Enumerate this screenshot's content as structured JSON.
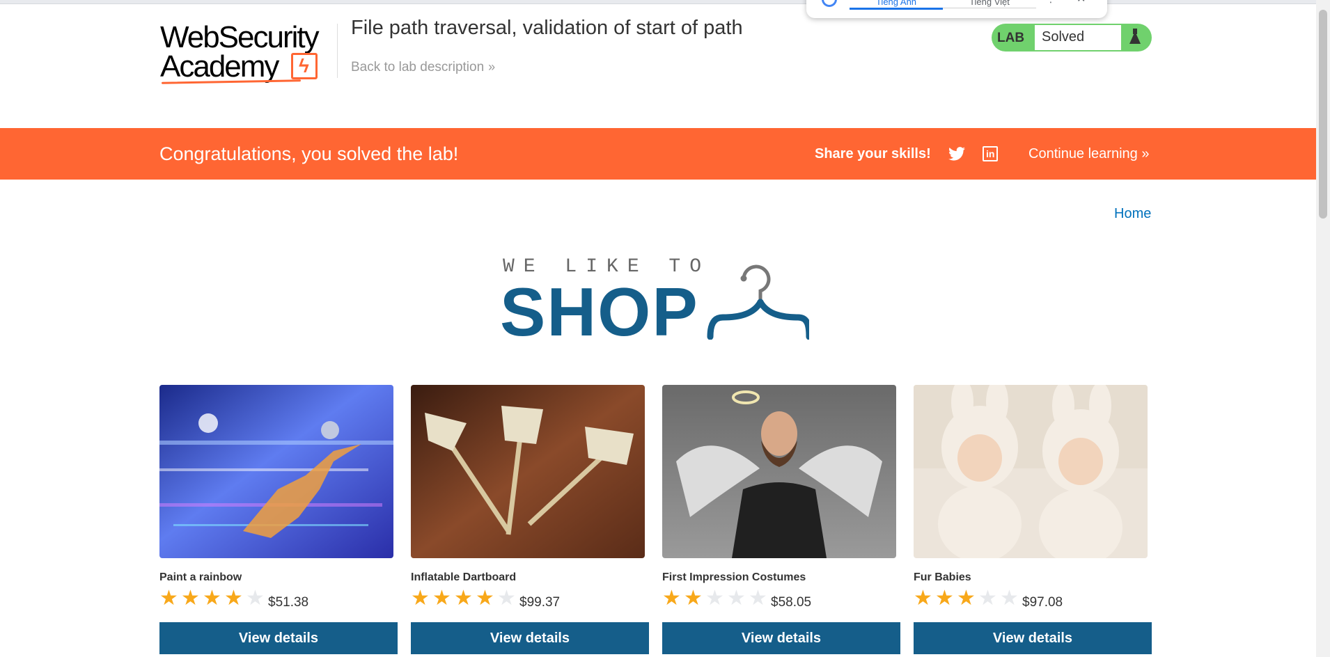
{
  "translate_popup": {
    "tab_1": "Tiếng Anh",
    "tab_2": "Tiếng Việt",
    "more": "⋮",
    "close": "✕"
  },
  "header": {
    "logo_line_1": "WebSecurity",
    "logo_line_2": "Academy",
    "lab_title": "File path traversal, validation of start of path",
    "back_link": "Back to lab description",
    "back_chevron": "»"
  },
  "lab_status": {
    "tag": "LAB",
    "value": "Solved"
  },
  "banner": {
    "message": "Congratulations, you solved the lab!",
    "share": "Share your skills!",
    "continue": "Continue learning »"
  },
  "nav": {
    "home": "Home"
  },
  "hero": {
    "small": "WE LIKE TO",
    "big": "SHOP"
  },
  "products": [
    {
      "name": "Paint a rainbow",
      "rating": 4,
      "price": "$51.38",
      "button": "View details"
    },
    {
      "name": "Inflatable Dartboard",
      "rating": 4,
      "price": "$99.37",
      "button": "View details"
    },
    {
      "name": "First Impression Costumes",
      "rating": 2,
      "price": "$58.05",
      "button": "View details"
    },
    {
      "name": "Fur Babies",
      "rating": 3,
      "price": "$97.08",
      "button": "View details"
    }
  ],
  "colors": {
    "accent": "#ff6633",
    "primary": "#155e8a",
    "link": "#0071bc",
    "star": "#f8a81a",
    "solved": "#70d16d"
  }
}
